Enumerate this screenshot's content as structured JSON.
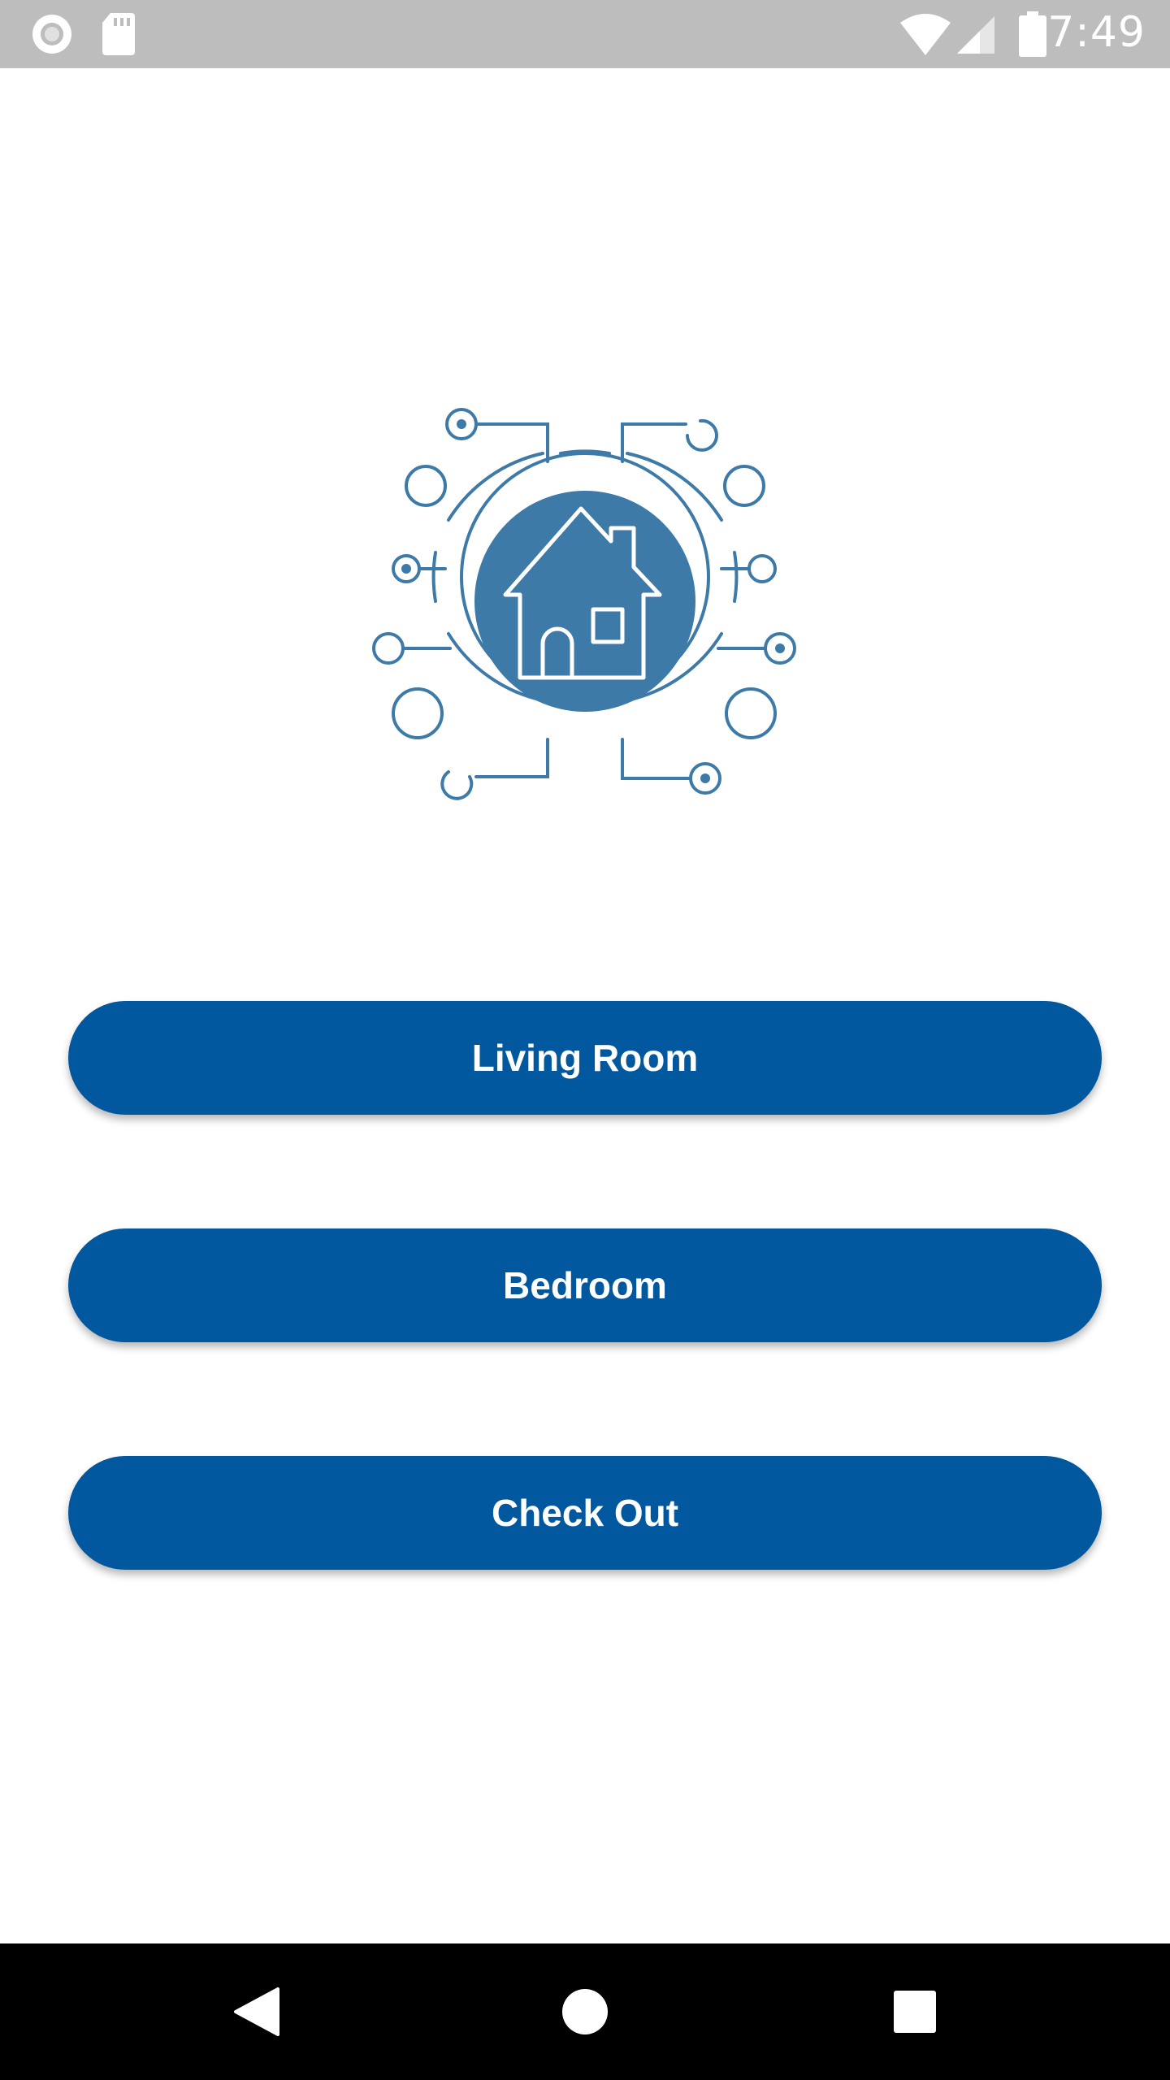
{
  "status_bar": {
    "time": "7:49",
    "icons": [
      "record-icon",
      "sd-card-icon",
      "wifi-icon",
      "signal-icon",
      "battery-icon"
    ]
  },
  "logo": {
    "icon": "smart-home-circuit-icon",
    "color": "#3d7aa8"
  },
  "buttons": {
    "living_room": "Living Room",
    "bedroom": "Bedroom",
    "check_out": "Check Out"
  },
  "colors": {
    "button_bg": "#02589e",
    "button_text": "#ffffff",
    "status_bar_bg": "#bdbdbd",
    "nav_bar_bg": "#000000"
  },
  "nav_bar": {
    "icons": [
      "back-icon",
      "home-icon",
      "recents-icon"
    ]
  }
}
